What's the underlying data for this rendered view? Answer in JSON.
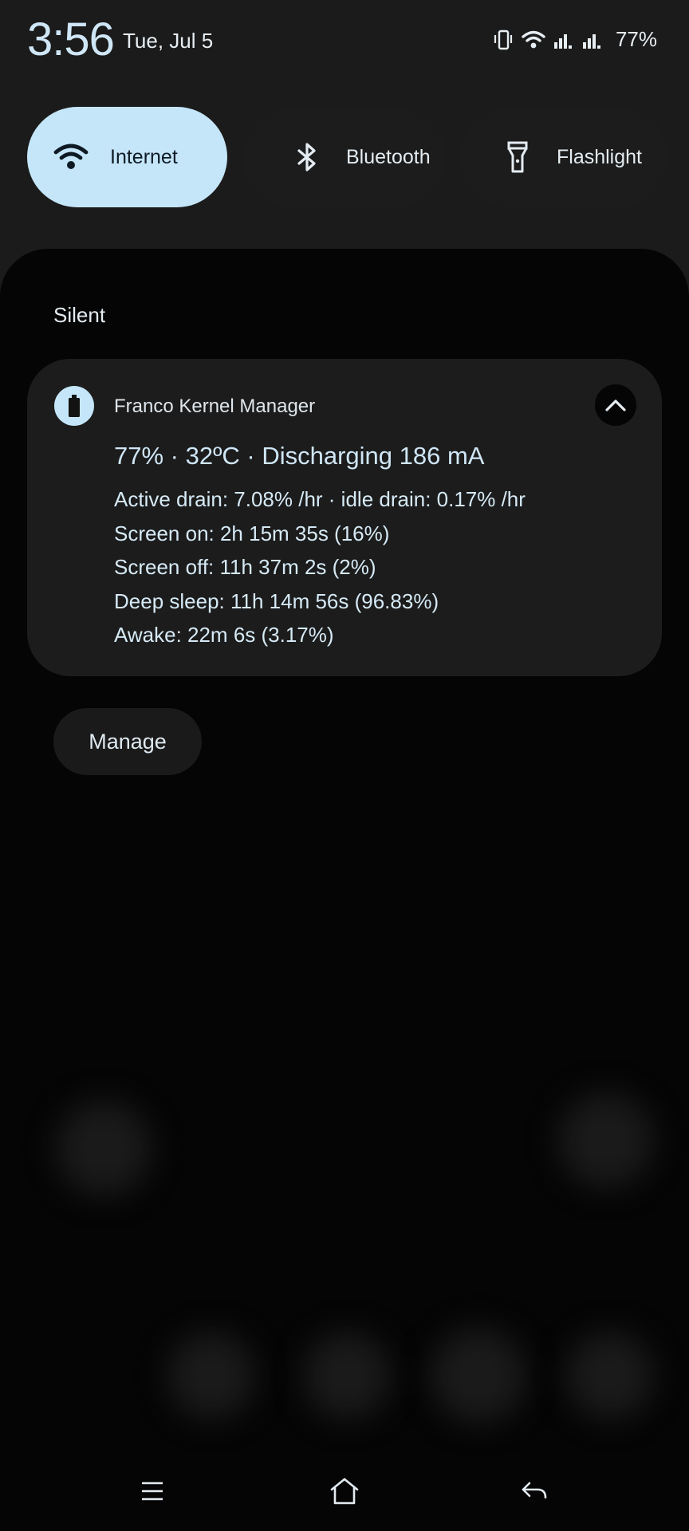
{
  "status_bar": {
    "time": "3:56",
    "date": "Tue, Jul 5",
    "battery_percent": "77%",
    "icons": [
      "vibrate-icon",
      "wifi-icon",
      "signal-icon",
      "signal-icon"
    ]
  },
  "quick_settings": {
    "tiles": [
      {
        "label": "Internet",
        "icon": "wifi-icon",
        "active": true
      },
      {
        "label": "Bluetooth",
        "icon": "bluetooth-icon",
        "active": false
      },
      {
        "label": "Flashlight",
        "icon": "flashlight-icon",
        "active": false
      }
    ]
  },
  "notifications": {
    "section_title": "Silent",
    "card": {
      "app_name": "Franco Kernel Manager",
      "app_icon": "battery-icon",
      "title": "77% · 32ºC · Discharging 186 mA",
      "lines": [
        "Active drain: 7.08% /hr · idle drain: 0.17% /hr",
        "Screen on: 2h 15m 35s  (16%)",
        "Screen off: 11h 37m 2s  (2%)",
        "Deep sleep: 11h 14m 56s  (96.83%)",
        "Awake: 22m 6s  (3.17%)"
      ],
      "expand_icon": "chevron-up-icon"
    },
    "manage_label": "Manage"
  },
  "nav_bar": {
    "buttons": [
      "recents-icon",
      "home-icon",
      "back-icon"
    ]
  },
  "colors": {
    "accent": "#c5e6f9",
    "shade_background": "#050505",
    "card_background": "#1c1c1c"
  }
}
